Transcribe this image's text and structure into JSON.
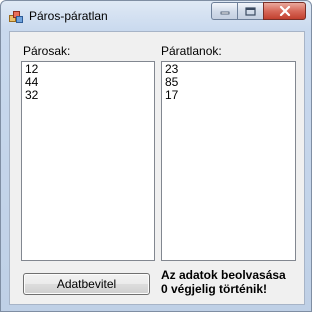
{
  "window": {
    "title": "Páros-páratlan"
  },
  "labels": {
    "even": "Párosak:",
    "odd": "Páratlanok:"
  },
  "even_list": [
    "12",
    "44",
    "32"
  ],
  "odd_list": [
    "23",
    "85",
    "17"
  ],
  "button": {
    "label": "Adatbevitel"
  },
  "note": {
    "line1": "Az adatok beolvasása",
    "line2": "0 végjelig történik!"
  }
}
